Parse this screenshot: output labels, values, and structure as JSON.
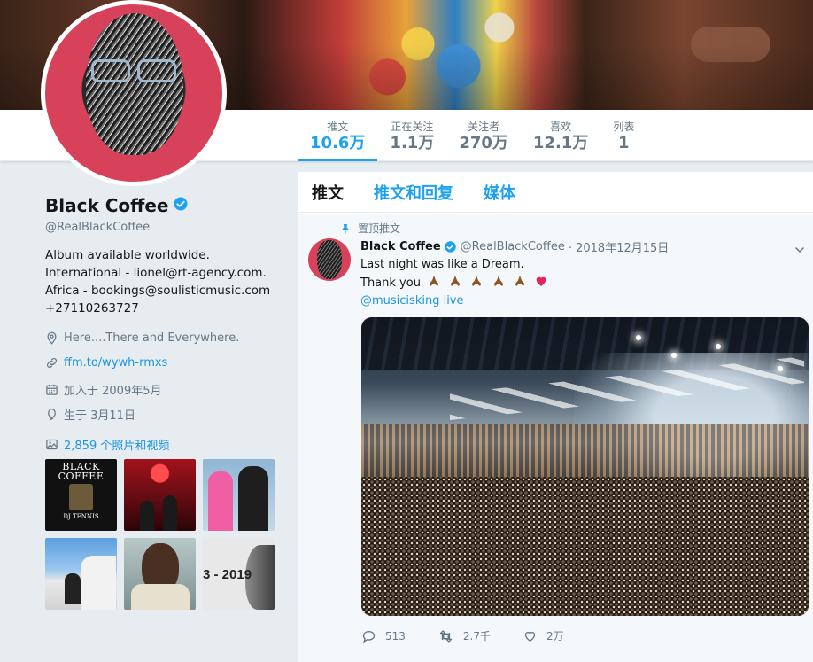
{
  "profile": {
    "name": "Black Coffee",
    "handle": "@RealBlackCoffee",
    "bio": "Album available worldwide. International - lionel@rt-agency.com. Africa - bookings@soulisticmusic.com +27110263727",
    "location": "Here....There and Everywhere.",
    "website": "ffm.to/wywh-rmxs",
    "joined": "加入于 2009年5月",
    "birthday": "生于 3月11日",
    "photos_link": "2,859 个照片和视频"
  },
  "stats": [
    {
      "label": "推文",
      "value": "10.6万"
    },
    {
      "label": "正在关注",
      "value": "1.1万"
    },
    {
      "label": "关注者",
      "value": "270万"
    },
    {
      "label": "喜欢",
      "value": "12.1万"
    },
    {
      "label": "列表",
      "value": "1"
    }
  ],
  "thumbs": {
    "t1_title": "BLACK COFFEE",
    "t1_sub": "DJ TENNIS",
    "t6_text": "3 - 2019"
  },
  "timeline_tabs": [
    "推文",
    "推文和回复",
    "媒体"
  ],
  "tweet": {
    "pinned_label": "置顶推文",
    "author": "Black Coffee",
    "handle": "@RealBlackCoffee",
    "date": "· 2018年12月15日",
    "line1": "Last night was like a Dream.",
    "line2": "Thank you",
    "mention": "@musicisking live",
    "replies": "513",
    "retweets": "2.7千",
    "likes": "2万"
  },
  "colors": {
    "accent": "#1da1f2",
    "link": "#1b95e0",
    "muted": "#657786",
    "heart": "#e0245e"
  },
  "icons": [
    "verified-icon",
    "location-icon",
    "link-icon",
    "calendar-icon",
    "balloon-icon",
    "photo-icon",
    "pin-icon",
    "chevron-down-icon",
    "reply-icon",
    "retweet-icon",
    "like-icon",
    "pray-emoji",
    "heart-emoji"
  ]
}
